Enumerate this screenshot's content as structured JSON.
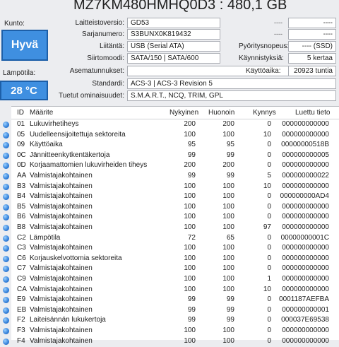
{
  "header": {
    "title": "MZ7KM480HMHQ0D3 : 480,1 GB"
  },
  "left": {
    "health_label": "Kunto:",
    "health_value": "Hyvä",
    "temp_label": "Lämpötila:",
    "temp_value": "28 °C"
  },
  "info": {
    "firmware": {
      "label": "Laitteistoversio:",
      "value": "GD53"
    },
    "serial": {
      "label": "Sarjanumero:",
      "value": "S3BUNX0K819432"
    },
    "interface": {
      "label": "Liitäntä:",
      "value": "USB (Serial ATA)"
    },
    "transfer": {
      "label": "Siirtomoodi:",
      "value": "SATA/150 | SATA/600"
    },
    "drive_letter": {
      "label": "Asematunnukset:",
      "value": ""
    },
    "standard": {
      "label": "Standardi:",
      "value": "ACS-3 | ACS-3 Revision 5"
    },
    "features": {
      "label": "Tuetut ominaisuudet:",
      "value": "S.M.A.R.T., NCQ, TRIM, GPL"
    },
    "dash1": "----",
    "dash2": "----",
    "dash3": "----",
    "dash4": "----",
    "rotation": {
      "label": "Pyöritysnopeus:",
      "value": "---- (SSD)"
    },
    "power_count": {
      "label": "Käynnistyksiä:",
      "value": "5 kertaa"
    },
    "power_hours": {
      "label": "Käyttöaika:",
      "value": "20923 tuntia"
    }
  },
  "table": {
    "headers": {
      "id": "ID",
      "attr": "Määrite",
      "current": "Nykyinen",
      "worst": "Huonoin",
      "threshold": "Kynnys",
      "raw": "Luettu tieto"
    },
    "rows": [
      {
        "id": "01",
        "attr": "Lukuvirhetiheys",
        "current": "200",
        "worst": "200",
        "threshold": "0",
        "raw": "000000000000"
      },
      {
        "id": "05",
        "attr": "Uudelleensijoitettuja sektoreita",
        "current": "100",
        "worst": "100",
        "threshold": "10",
        "raw": "000000000000"
      },
      {
        "id": "09",
        "attr": "Käyttöaika",
        "current": "95",
        "worst": "95",
        "threshold": "0",
        "raw": "00000000518B"
      },
      {
        "id": "0C",
        "attr": "Jännitteenkytkentäkertoja",
        "current": "99",
        "worst": "99",
        "threshold": "0",
        "raw": "000000000005"
      },
      {
        "id": "0D",
        "attr": "Korjaamattomien lukuvirheiden tiheys",
        "current": "200",
        "worst": "200",
        "threshold": "0",
        "raw": "000000000000"
      },
      {
        "id": "AA",
        "attr": "Valmistajakohtainen",
        "current": "99",
        "worst": "99",
        "threshold": "5",
        "raw": "000000000022"
      },
      {
        "id": "B3",
        "attr": "Valmistajakohtainen",
        "current": "100",
        "worst": "100",
        "threshold": "10",
        "raw": "000000000000"
      },
      {
        "id": "B4",
        "attr": "Valmistajakohtainen",
        "current": "100",
        "worst": "100",
        "threshold": "0",
        "raw": "000000000AD4"
      },
      {
        "id": "B5",
        "attr": "Valmistajakohtainen",
        "current": "100",
        "worst": "100",
        "threshold": "0",
        "raw": "000000000000"
      },
      {
        "id": "B6",
        "attr": "Valmistajakohtainen",
        "current": "100",
        "worst": "100",
        "threshold": "0",
        "raw": "000000000000"
      },
      {
        "id": "B8",
        "attr": "Valmistajakohtainen",
        "current": "100",
        "worst": "100",
        "threshold": "97",
        "raw": "000000000000"
      },
      {
        "id": "C2",
        "attr": "Lämpötila",
        "current": "72",
        "worst": "65",
        "threshold": "0",
        "raw": "00000000001C"
      },
      {
        "id": "C3",
        "attr": "Valmistajakohtainen",
        "current": "100",
        "worst": "100",
        "threshold": "0",
        "raw": "000000000000"
      },
      {
        "id": "C6",
        "attr": "Korjauskelvottomia sektoreita",
        "current": "100",
        "worst": "100",
        "threshold": "0",
        "raw": "000000000000"
      },
      {
        "id": "C7",
        "attr": "Valmistajakohtainen",
        "current": "100",
        "worst": "100",
        "threshold": "0",
        "raw": "000000000000"
      },
      {
        "id": "C9",
        "attr": "Valmistajakohtainen",
        "current": "100",
        "worst": "100",
        "threshold": "1",
        "raw": "000000000000"
      },
      {
        "id": "CA",
        "attr": "Valmistajakohtainen",
        "current": "100",
        "worst": "100",
        "threshold": "10",
        "raw": "000000000000"
      },
      {
        "id": "E9",
        "attr": "Valmistajakohtainen",
        "current": "99",
        "worst": "99",
        "threshold": "0",
        "raw": "0001187AEFBA"
      },
      {
        "id": "EB",
        "attr": "Valmistajakohtainen",
        "current": "99",
        "worst": "99",
        "threshold": "0",
        "raw": "000000000001"
      },
      {
        "id": "F2",
        "attr": "Laiteisännän lukukertoja",
        "current": "99",
        "worst": "99",
        "threshold": "0",
        "raw": "000037E69538"
      },
      {
        "id": "F3",
        "attr": "Valmistajakohtainen",
        "current": "100",
        "worst": "100",
        "threshold": "0",
        "raw": "000000000000"
      },
      {
        "id": "F4",
        "attr": "Valmistajakohtainen",
        "current": "100",
        "worst": "100",
        "threshold": "0",
        "raw": "000000000000"
      }
    ]
  }
}
